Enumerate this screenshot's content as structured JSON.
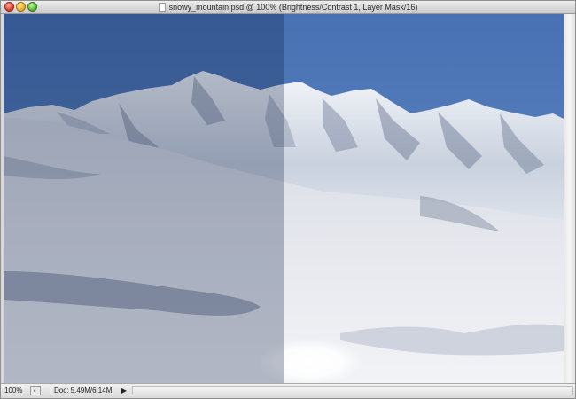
{
  "window": {
    "title": "snowy_mountain.psd @ 100% (Brightness/Contrast 1, Layer Mask/16)"
  },
  "status": {
    "zoom": "100%",
    "doc_info": "Doc: 5.49M/6.14M",
    "menu_arrow": "▶"
  },
  "icons": {
    "close": "close-icon",
    "minimize": "minimize-icon",
    "zoom": "zoom-icon",
    "document": "document-icon",
    "status": "status-icon"
  },
  "colors": {
    "sky_left": "#2f4e86",
    "sky_right": "#4d76b6",
    "snow": "#e6eaf2"
  }
}
